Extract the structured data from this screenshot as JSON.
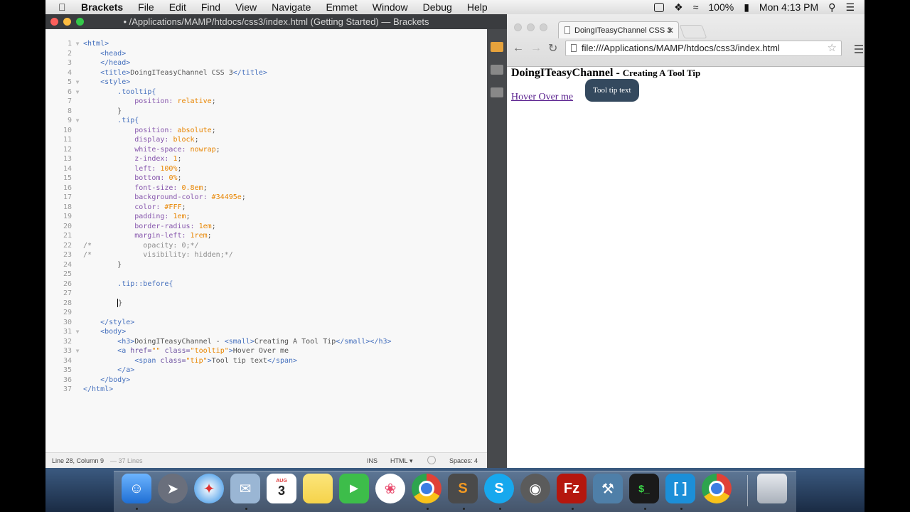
{
  "menubar": {
    "app_name": "Brackets",
    "items": [
      "File",
      "Edit",
      "Find",
      "View",
      "Navigate",
      "Emmet",
      "Window",
      "Debug",
      "Help"
    ],
    "battery": "100%",
    "clock": "Mon 4:13 PM"
  },
  "editor": {
    "window_title": "• /Applications/MAMP/htdocs/css3/index.html (Getting Started) — Brackets",
    "status": {
      "position": "Line 28, Column 9",
      "lines": "— 37 Lines",
      "mode": "INS",
      "language": "HTML",
      "spaces": "Spaces: 4"
    }
  },
  "browser": {
    "tab_title": "DoingITeasyChannel CSS 3",
    "url": "file:///Applications/MAMP/htdocs/css3/index.html",
    "page": {
      "heading": "DoingITeasyChannel - ",
      "heading_small": "Creating A Tool Tip",
      "link_text": "Hover Over me",
      "tooltip_text": "Tool tip text"
    }
  },
  "dock": {
    "apps": [
      "finder-icon",
      "launchpad-icon",
      "safari-icon",
      "mail-icon",
      "calendar-icon",
      "notes-icon",
      "facetime-icon",
      "photos-icon",
      "chrome-icon",
      "sublime-icon",
      "skype-icon",
      "sequel-pro-icon",
      "filezilla-icon",
      "xcode-icon",
      "terminal-icon",
      "brackets-icon",
      "chrome-canary-icon",
      "trash-icon"
    ],
    "calendar_month": "AUG",
    "calendar_day": "3"
  }
}
